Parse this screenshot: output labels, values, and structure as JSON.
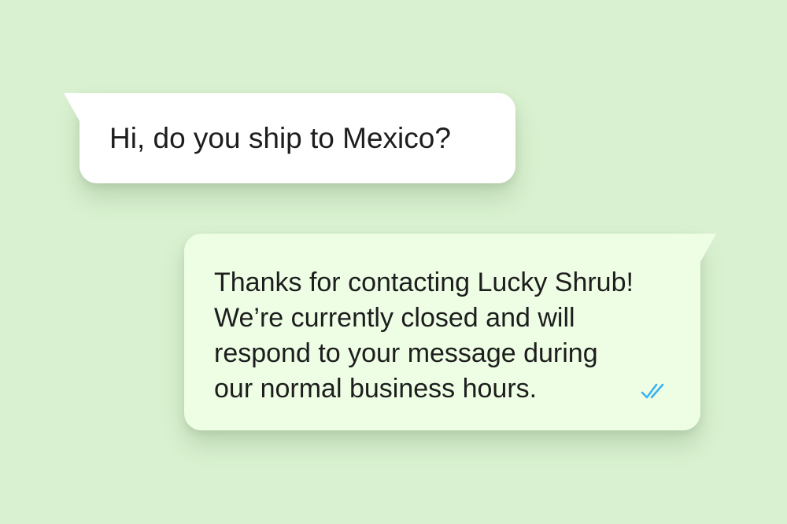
{
  "chat": {
    "incoming": {
      "text": "Hi, do you ship to Mexico?"
    },
    "outgoing": {
      "lines": [
        "Thanks for contacting Lucky Shrub!",
        "We’re currently closed and will",
        "respond to your message during",
        "our normal business hours."
      ],
      "status_icon": "double-check-read-icon"
    }
  },
  "colors": {
    "background": "#d9f1d0",
    "incoming_bubble": "#ffffff",
    "outgoing_bubble": "#eefee5",
    "read_tick": "#3ab3ee",
    "text": "#1d1d1d"
  }
}
